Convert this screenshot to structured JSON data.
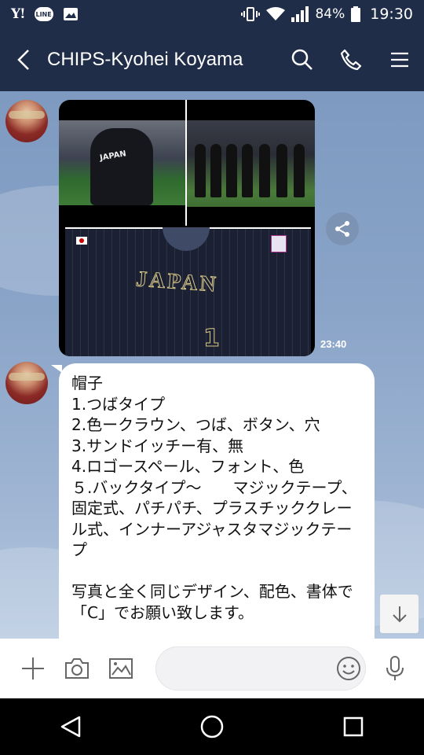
{
  "status_bar": {
    "left_y_text": "Y!",
    "left_line_text": "LINE",
    "battery": "84%",
    "time": "19:30"
  },
  "header": {
    "title": "CHIPS-Kyohei Koyama"
  },
  "messages": [
    {
      "type": "image",
      "jersey_text": "JAPAN",
      "jersey_number": "1",
      "player_text": "JAPAN",
      "time": "23:40"
    },
    {
      "type": "text",
      "text": "帽子\n1.つばタイプ\n2.色ークラウン、つば、ボタン、穴\n3.サンドイッチー有、無\n4.ロゴースペール、フォント、色\n５.バックタイプ〜　　マジックテープ、固定式、パチパチ、プラスチッククレール式、インナーアジャスタマジックテープ\n\n写真と全く同じデザイン、配色、書体で\n「C」でお願い致します。"
    }
  ],
  "input": {
    "placeholder": ""
  },
  "colors": {
    "header_bg": "#1f2d48",
    "chat_bg": "#8aa4c8",
    "bubble_bg": "#ffffff"
  },
  "icons": [
    "back-icon",
    "search-icon",
    "phone-icon",
    "menu-icon",
    "share-icon",
    "arrow-down-icon",
    "plus-icon",
    "camera-icon",
    "image-icon",
    "emoji-icon",
    "mic-icon",
    "nav-back-icon",
    "nav-home-icon",
    "nav-recents-icon"
  ]
}
